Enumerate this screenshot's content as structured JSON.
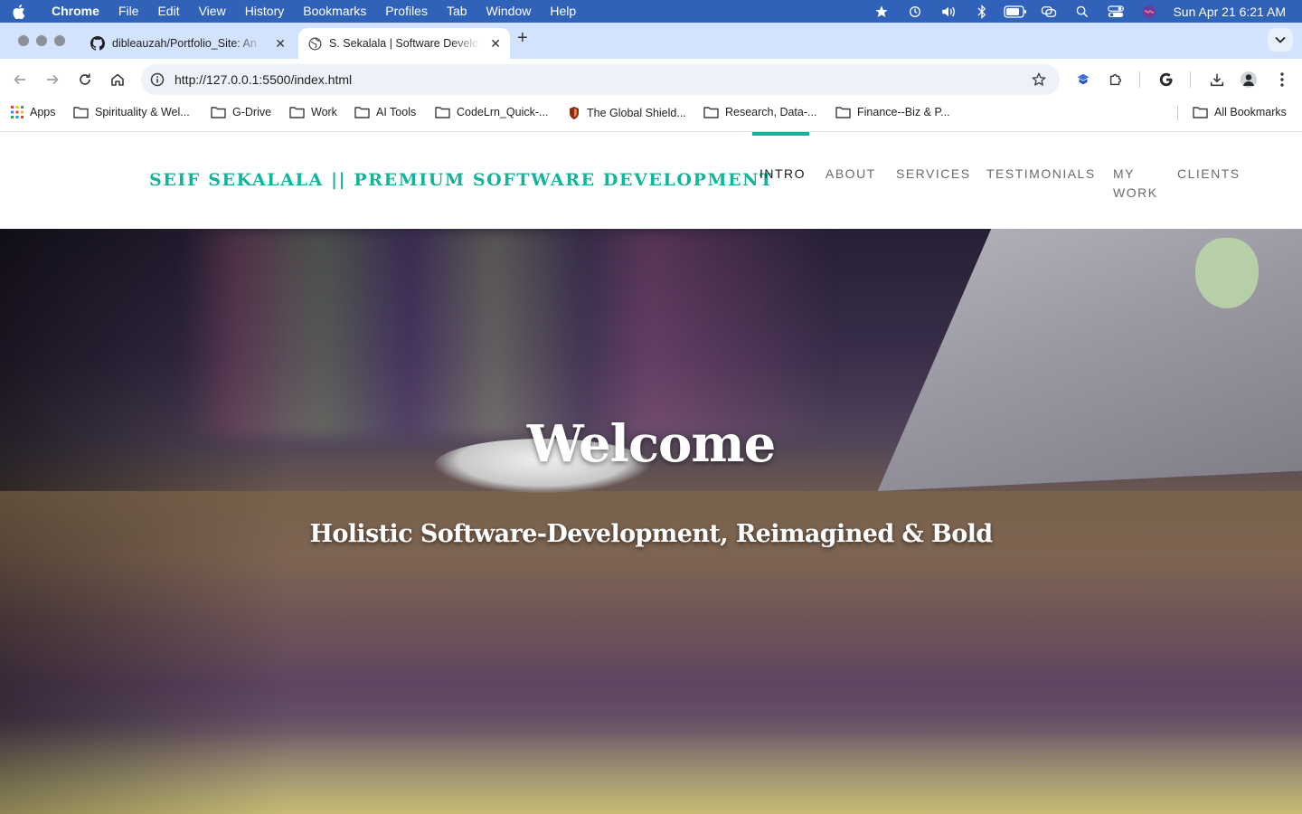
{
  "menubar": {
    "app_name": "Chrome",
    "items": [
      "File",
      "Edit",
      "View",
      "History",
      "Bookmarks",
      "Profiles",
      "Tab",
      "Window",
      "Help"
    ],
    "clock": "Sun Apr 21  6:21 AM",
    "status_icons": [
      "star-icon",
      "time-machine-icon",
      "volume-icon",
      "bluetooth-icon",
      "battery-icon",
      "screen-mirroring-icon",
      "spotlight-icon",
      "control-center-icon",
      "siri-icon"
    ]
  },
  "tabs": [
    {
      "title": "dibleauzah/Portfolio_Site: An",
      "icon": "github-icon",
      "active": false
    },
    {
      "title": "S. Sekalala | Software Develo",
      "icon": "globe-icon",
      "active": true
    }
  ],
  "omnibox": {
    "url": "http://127.0.0.1:5500/index.html"
  },
  "bookmarks": {
    "apps_label": "Apps",
    "items": [
      {
        "label": "Spirituality & Wel...",
        "icon": "folder-icon"
      },
      {
        "label": "G-Drive",
        "icon": "folder-icon"
      },
      {
        "label": "Work",
        "icon": "folder-icon"
      },
      {
        "label": "AI Tools",
        "icon": "folder-icon"
      },
      {
        "label": "CodeLrn_Quick-...",
        "icon": "folder-icon"
      },
      {
        "label": "The Global Shield...",
        "icon": "shield-favicon-icon"
      },
      {
        "label": "Research, Data-...",
        "icon": "folder-icon"
      },
      {
        "label": "Finance--Biz & P...",
        "icon": "folder-icon"
      }
    ],
    "all_bookmarks": "All Bookmarks"
  },
  "site": {
    "brand": "SEIF SEKALALA || PREMIUM SOFTWARE DEVELOPMENT",
    "nav": [
      {
        "label": "INTRO",
        "active": true
      },
      {
        "label": "ABOUT",
        "active": false
      },
      {
        "label": "SERVICES",
        "active": false
      },
      {
        "label": "TESTIMONIALS",
        "active": false
      },
      {
        "label": "MY",
        "label2": "WORK",
        "active": false
      },
      {
        "label": "CLIENTS",
        "active": false
      }
    ],
    "accent_color": "#13b499",
    "hero": {
      "title": "Welcome",
      "subtitle": "Holistic Software-Development, Reimagined & Bold"
    }
  }
}
